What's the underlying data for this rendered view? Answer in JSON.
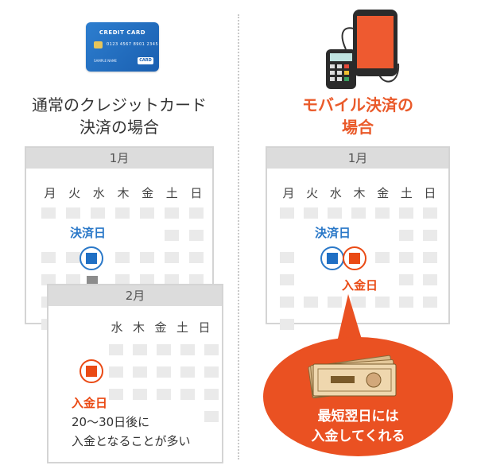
{
  "left": {
    "card": {
      "title": "CREDIT CARD",
      "number": "0123 4567 8901 2345",
      "holder": "SAMPLE NAME",
      "label": "CARD"
    },
    "heading_line1": "通常のクレジットカード",
    "heading_line2": "決済の場合",
    "calendar1": {
      "month": "1月",
      "weekdays": [
        "月",
        "火",
        "水",
        "木",
        "金",
        "土",
        "日"
      ]
    },
    "payment_label": "決済日",
    "calendar2": {
      "month": "2月",
      "weekdays_visible": [
        "水",
        "木",
        "金",
        "土",
        "日"
      ]
    },
    "deposit_label": "入金日",
    "note_line1": "20〜30日後に",
    "note_line2": "入金となることが多い"
  },
  "right": {
    "heading_line1": "モバイル決済の",
    "heading_line2": "場合",
    "calendar": {
      "month": "1月",
      "weekdays": [
        "月",
        "火",
        "水",
        "木",
        "金",
        "土",
        "日"
      ]
    },
    "payment_label": "決済日",
    "deposit_label": "入金日",
    "bubble_line1": "最短翌日には",
    "bubble_line2": "入金してくれる"
  },
  "colors": {
    "accent_orange": "#ea5122",
    "accent_blue": "#2a78c8",
    "calendar_gray": "#dcdcdc"
  }
}
